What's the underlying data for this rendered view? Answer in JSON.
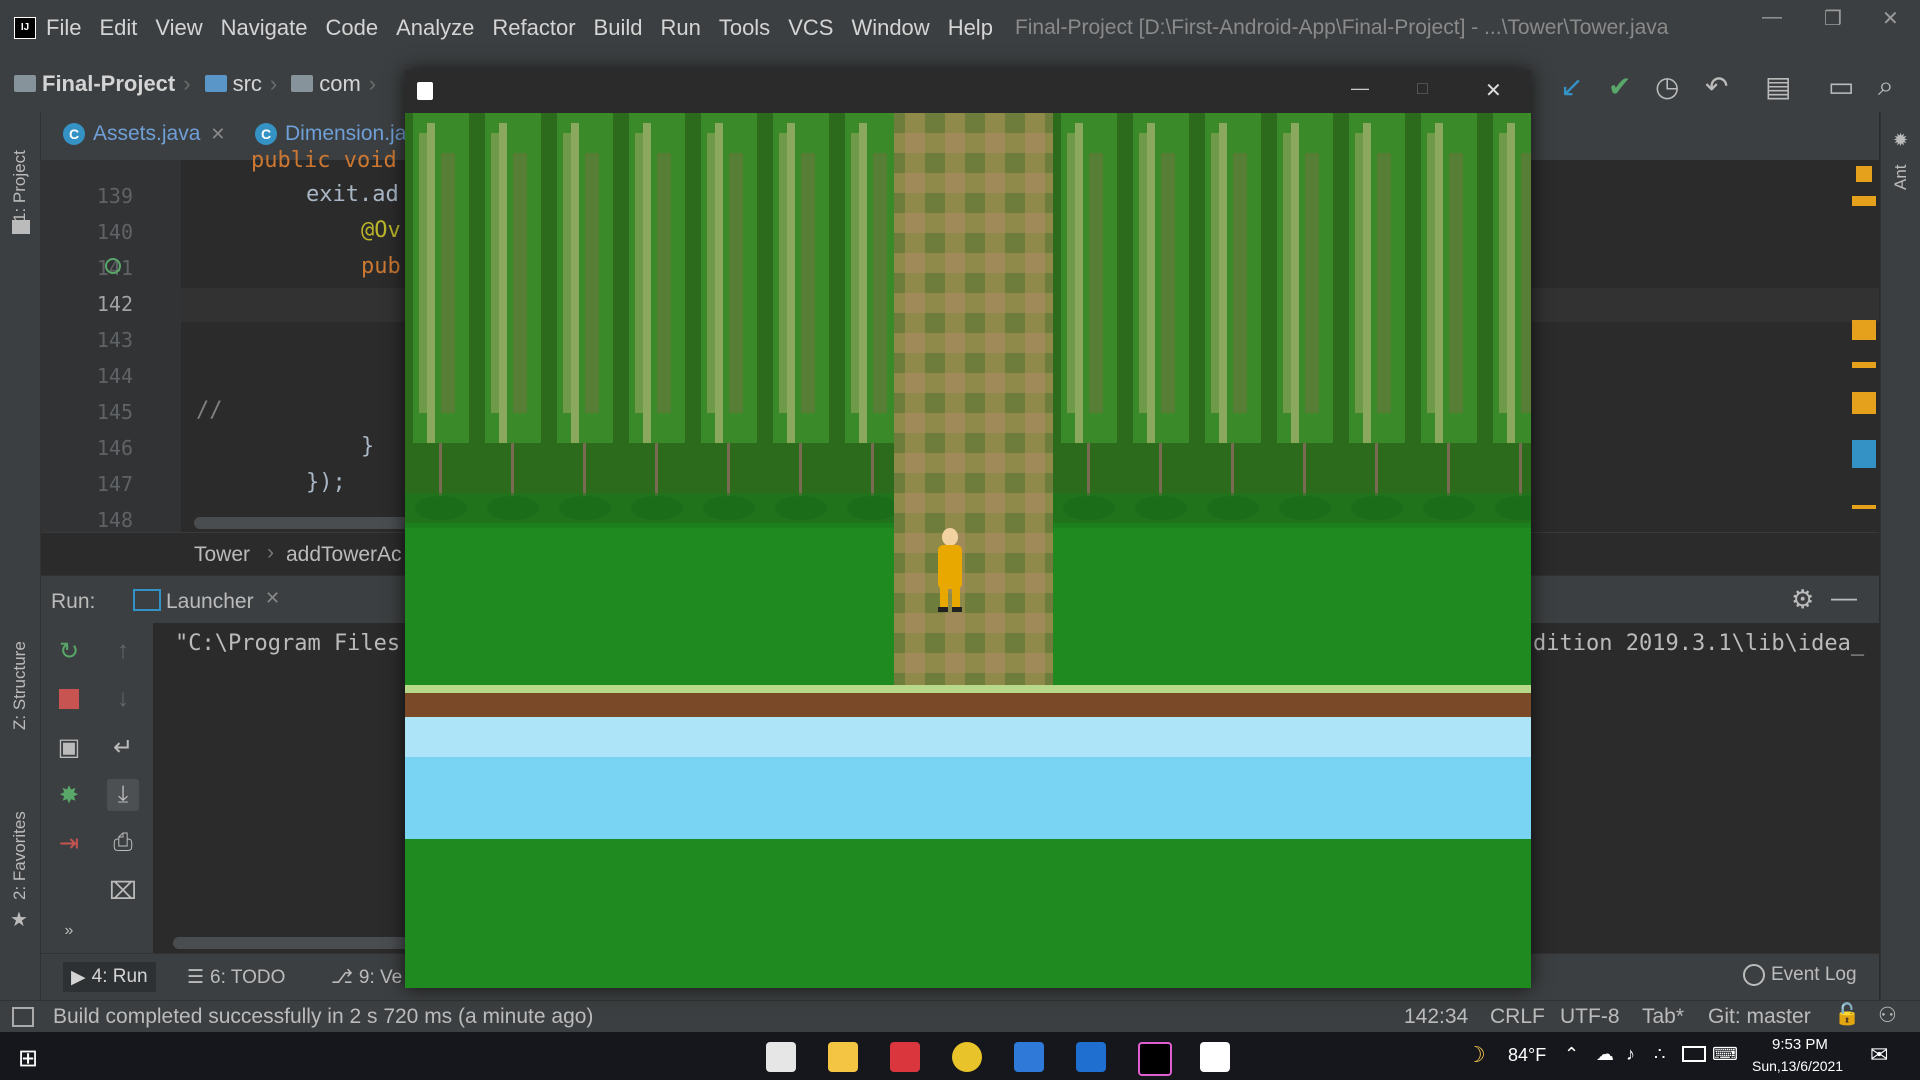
{
  "menubar": {
    "items": [
      "File",
      "Edit",
      "View",
      "Navigate",
      "Code",
      "Analyze",
      "Refactor",
      "Build",
      "Run",
      "Tools",
      "VCS",
      "Window",
      "Help"
    ],
    "window_title": "Final-Project [D:\\First-Android-App\\Final-Project] - ...\\Tower\\Tower.java"
  },
  "navbar": {
    "crumbs": [
      "Final-Project",
      "src",
      "com"
    ]
  },
  "left_strip": {
    "project": "1: Project",
    "structure": "Z: Structure",
    "favorites": "2: Favorites"
  },
  "right_strip": {
    "ant": "Ant"
  },
  "tabs": [
    {
      "label": "Assets.java"
    },
    {
      "label": "Dimension.ja"
    }
  ],
  "editor": {
    "line_numbers": [
      "139",
      "140",
      "141",
      "142",
      "143",
      "144",
      "145",
      "146",
      "147",
      "148"
    ],
    "current_line": "142",
    "top_partial": "public void",
    "lines": [
      "exit.ad",
      "@Ov",
      "pub",
      "",
      "",
      "",
      "//",
      "}",
      "});",
      ""
    ]
  },
  "code_breadcrumbs": {
    "class": "Tower",
    "method": "addTowerAc"
  },
  "run_panel": {
    "label": "Run:",
    "config": "Launcher",
    "console_left": "\"C:\\Program Files",
    "console_right": "dition 2019.3.1\\lib\\idea_"
  },
  "bottom_tabs": {
    "run": "4: Run",
    "todo": "6: TODO",
    "vcs": "9: Ve",
    "event_log": "Event Log"
  },
  "status": {
    "message": "Build completed successfully in 2 s 720 ms (a minute ago)",
    "position": "142:34",
    "line_sep": "CRLF",
    "encoding": "UTF-8",
    "indent": "Tab*",
    "git": "Git: master"
  },
  "taskbar": {
    "temperature": "84°F",
    "time": "9:53 PM",
    "date": "Sun,13/6/2021"
  },
  "colors": {
    "grass": "#1f8a1f",
    "forest": "#2e6b1c",
    "water": "#79d4f4",
    "path": "#8d8a4a",
    "player": "#e8a800"
  }
}
